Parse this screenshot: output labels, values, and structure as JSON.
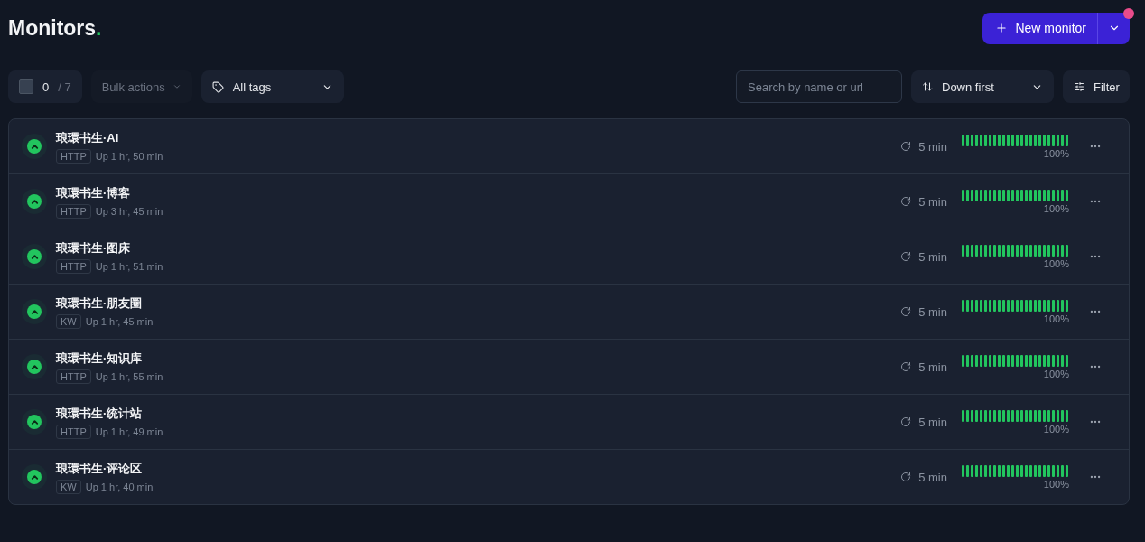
{
  "header": {
    "title": "Monitors",
    "title_mark": ".",
    "new_button": "New monitor"
  },
  "toolbar": {
    "select_all": {
      "checked": false
    },
    "selected_count": "0",
    "total_count": "/ 7",
    "bulk_actions": {
      "label": "Bulk actions",
      "disabled": true
    },
    "tags": "All tags",
    "search": {
      "placeholder": "Search by name or url"
    },
    "sort": "Down first",
    "filter": "Filter"
  },
  "monitors": [
    {
      "name": "琅環书生·AI",
      "type": "HTTP",
      "uptime": "Up 1 hr, 50 min",
      "up": true,
      "interval": "5 min",
      "percent": "100%"
    },
    {
      "name": "琅環书生·博客",
      "type": "HTTP",
      "uptime": "Up 3 hr, 45 min",
      "up": true,
      "interval": "5 min",
      "percent": "100%"
    },
    {
      "name": "琅環书生·图床",
      "type": "HTTP",
      "uptime": "Up 1 hr, 51 min",
      "up": true,
      "interval": "5 min",
      "percent": "100%"
    },
    {
      "name": "琅環书生·朋友圈",
      "type": "KW",
      "uptime": "Up 1 hr, 45 min",
      "up": true,
      "interval": "5 min",
      "percent": "100%"
    },
    {
      "name": "琅環书生·知识库",
      "type": "HTTP",
      "uptime": "Up 1 hr, 55 min",
      "up": true,
      "interval": "5 min",
      "percent": "100%"
    },
    {
      "name": "琅環书生·统计站",
      "type": "HTTP",
      "uptime": "Up 1 hr, 49 min",
      "up": true,
      "interval": "5 min",
      "percent": "100%"
    },
    {
      "name": "琅環书生·评论区",
      "type": "KW",
      "uptime": "Up 1 hr, 40 min",
      "up": true,
      "interval": "5 min",
      "percent": "100%"
    }
  ]
}
